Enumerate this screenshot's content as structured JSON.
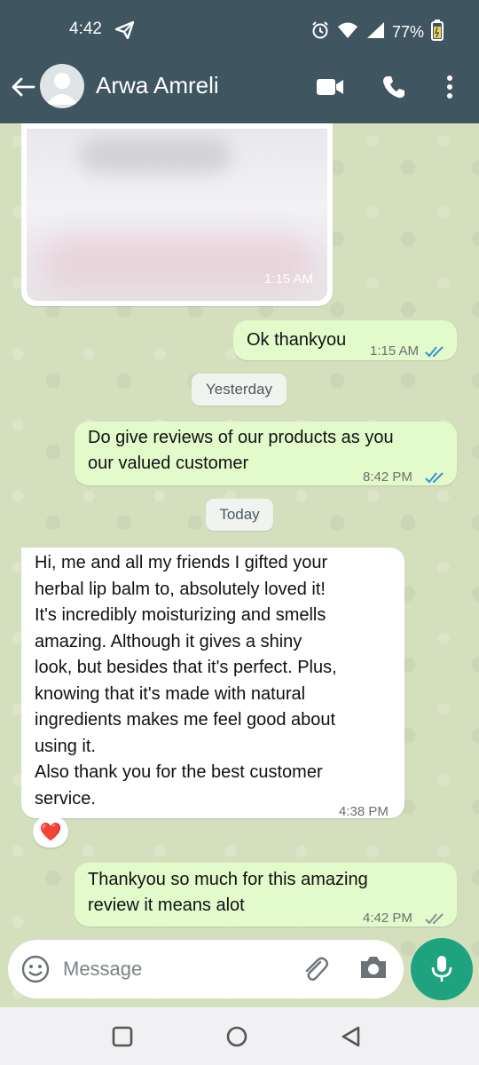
{
  "status_bar": {
    "time": "4:42",
    "battery": "77%"
  },
  "header": {
    "contact_name": "Arwa Amreli"
  },
  "messages": {
    "image_time": "1:15 AM",
    "ok_thanks": {
      "text": "Ok thankyou",
      "time": "1:15 AM"
    },
    "date_yesterday": "Yesterday",
    "review_request": {
      "line1": "Do give reviews of our products as you",
      "line2": "our valued customer",
      "time": "8:42 PM"
    },
    "date_today": "Today",
    "review": {
      "lines": [
        "Hi, me and all my friends I gifted your",
        "herbal lip balm to, absolutely loved it!",
        "It's incredibly moisturizing and smells",
        "amazing. Although it gives a shiny",
        "look, but besides that it's perfect. Plus,",
        "knowing that it's made with natural",
        "ingredients makes me feel good about",
        "using it.",
        "Also thank you for the best customer",
        "service."
      ],
      "time": "4:38 PM",
      "reaction": "❤️"
    },
    "thankyou": {
      "line1": "Thankyou so much for this amazing",
      "line2": "review it means alot",
      "time": "4:42 PM"
    }
  },
  "composer": {
    "placeholder": "Message"
  },
  "colors": {
    "header_bg": "#3f5560",
    "incoming_bubble": "#ffffff",
    "outgoing_bubble": "#e3fbcb",
    "mic_button": "#1fa37f",
    "read_tick": "#3b8fd6"
  },
  "icons": [
    "telegram-icon",
    "alarm-icon",
    "wifi-icon",
    "signal-icon",
    "battery-icon",
    "back-arrow-icon",
    "video-call-icon",
    "phone-icon",
    "more-vert-icon",
    "emoji-icon",
    "attach-icon",
    "camera-icon",
    "mic-icon",
    "nav-recents-icon",
    "nav-home-icon",
    "nav-back-icon"
  ]
}
